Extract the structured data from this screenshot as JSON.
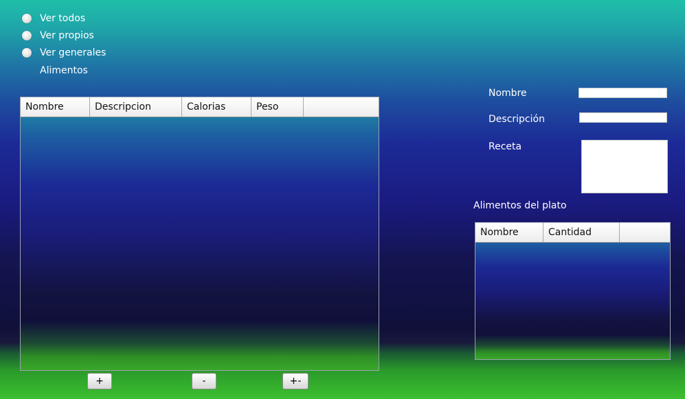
{
  "filters": [
    {
      "label": "Ver todos"
    },
    {
      "label": "Ver propios"
    },
    {
      "label": "Ver generales"
    }
  ],
  "alimentos_label": "Alimentos",
  "alimentos_table": {
    "columns": [
      "Nombre",
      "Descripcion",
      "Calorias",
      "Peso"
    ]
  },
  "buttons": {
    "add": "+",
    "remove": "-",
    "edit": "+-"
  },
  "form": {
    "nombre_label": "Nombre",
    "descripcion_label": "Descripción",
    "receta_label": "Receta",
    "nombre_value": "",
    "descripcion_value": "",
    "receta_value": ""
  },
  "plato_label": "Alimentos del plato",
  "plato_table": {
    "columns": [
      "Nombre",
      "Cantidad"
    ]
  }
}
